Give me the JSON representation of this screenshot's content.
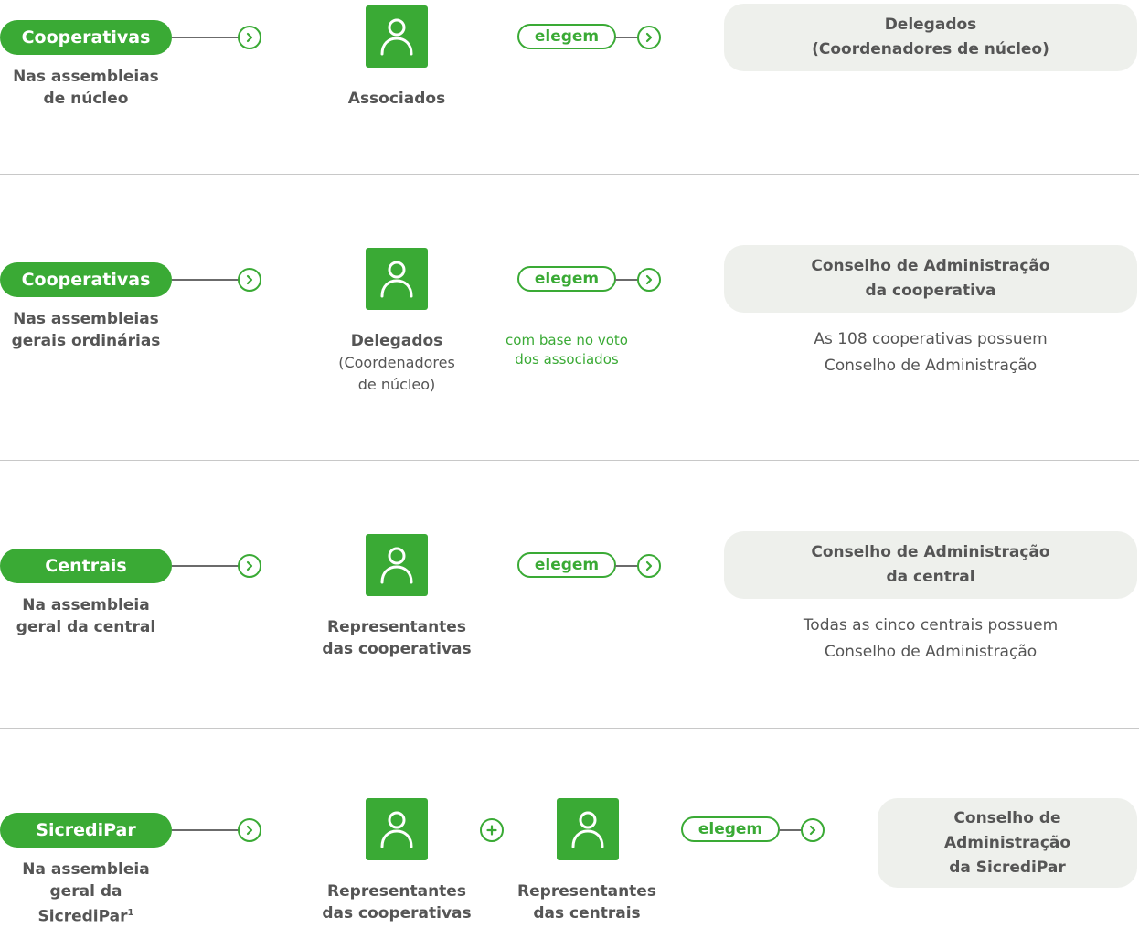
{
  "colors": {
    "accent": "#3aaa35",
    "result_bg": "#eef0ec",
    "text": "#555555"
  },
  "icons": {
    "arrow": "chevron-right-circle-icon",
    "person": "user-icon",
    "plus": "plus-circle-icon"
  },
  "rows": [
    {
      "pill": "Cooperativas",
      "scope": [
        "Nas assembleias",
        "de núcleo"
      ],
      "electors": [
        {
          "title": "Associados"
        }
      ],
      "verb": "elegem",
      "note": [],
      "result": [
        "Delegados",
        "(Coordenadores de núcleo)"
      ],
      "result_note": []
    },
    {
      "pill": "Cooperativas",
      "scope": [
        "Nas assembleias",
        "gerais ordinárias"
      ],
      "electors": [
        {
          "title": "Delegados",
          "sub": [
            "(Coordenadores",
            "de núcleo)"
          ]
        }
      ],
      "verb": "elegem",
      "note": [
        "com base no voto",
        "dos associados"
      ],
      "result": [
        "Conselho de Administração",
        "da cooperativa"
      ],
      "result_note": [
        "As 108 cooperativas possuem",
        "Conselho de Administração"
      ]
    },
    {
      "pill": "Centrais",
      "scope": [
        "Na assembleia",
        "geral da central"
      ],
      "electors": [
        {
          "title": "Representantes das cooperativas"
        }
      ],
      "verb": "elegem",
      "note": [],
      "result": [
        "Conselho de Administração",
        "da central"
      ],
      "result_note": [
        "Todas as cinco centrais possuem",
        "Conselho de Administração"
      ]
    },
    {
      "pill": "SicrediPar",
      "scope": [
        "Na assembleia",
        "geral da SicrediPar"
      ],
      "scope_sup": "1",
      "electors": [
        {
          "title": "Representantes das cooperativas"
        },
        {
          "title": "Representantes das centrais"
        }
      ],
      "verb": "elegem",
      "note": [],
      "result": [
        "Conselho de",
        "Administração",
        "da SicrediPar"
      ],
      "result_note": []
    }
  ]
}
